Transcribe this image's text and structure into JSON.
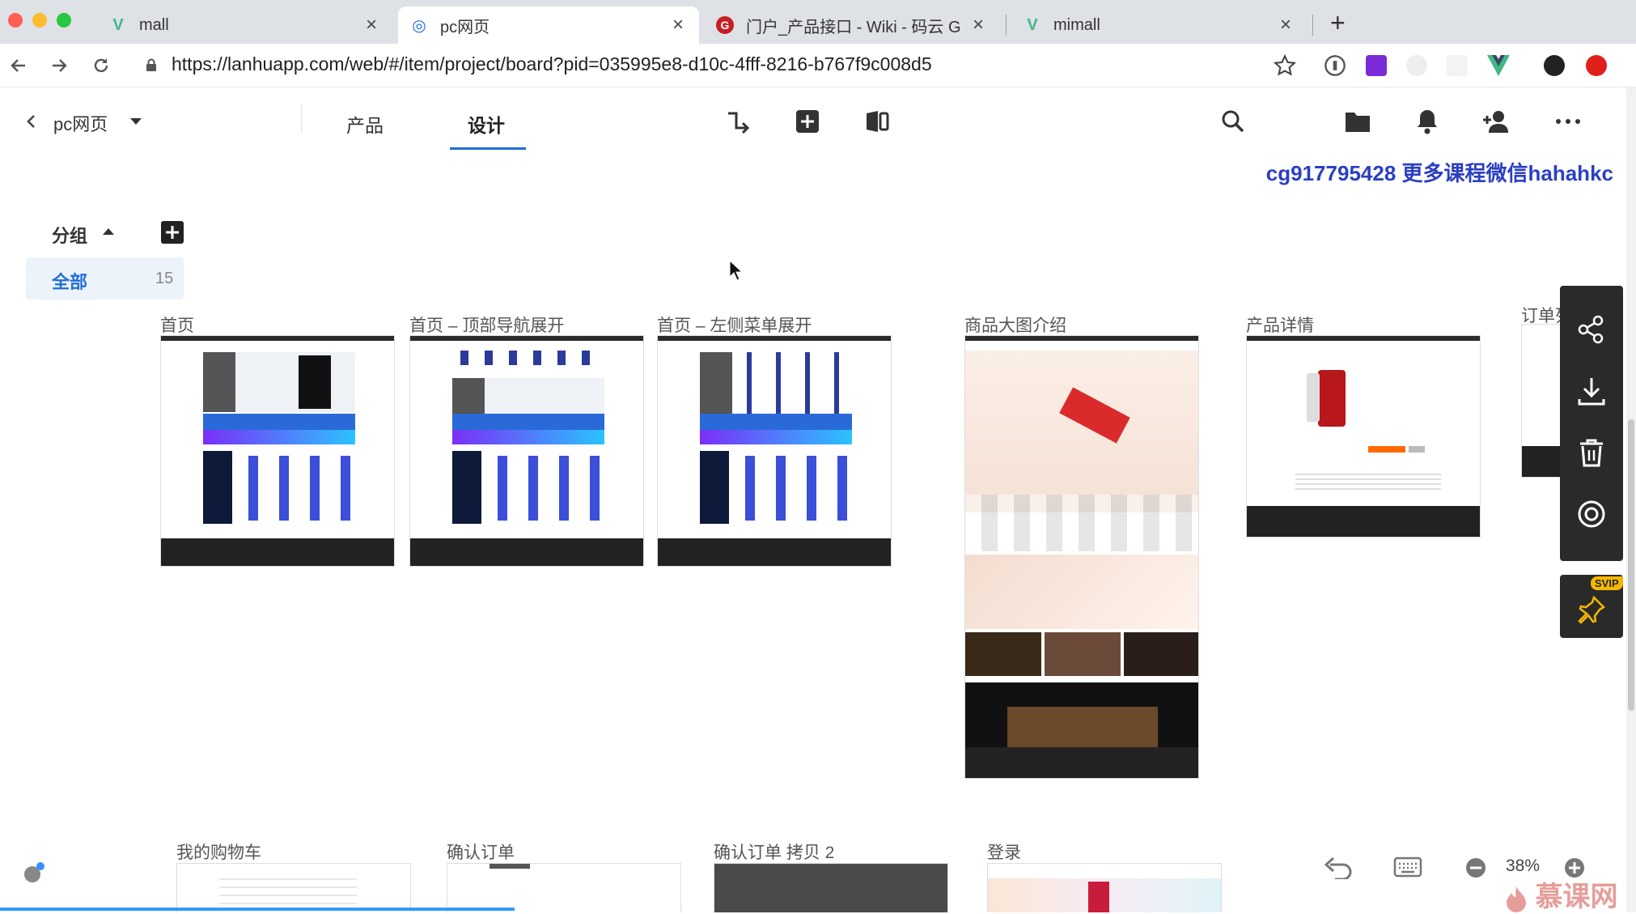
{
  "browser": {
    "tabs": [
      {
        "title": "mall",
        "close": "×"
      },
      {
        "title": "pc网页",
        "close": "×"
      },
      {
        "title": "门户_产品接口 - Wiki - 码云 Gitee",
        "close": "×"
      },
      {
        "title": "mimall",
        "close": "×"
      }
    ],
    "new_tab": "+",
    "url": "https://lanhuapp.com/web/#/item/project/board?pid=035995e8-d10c-4fff-8216-b767f9c008d5"
  },
  "app": {
    "project_name": "pc网页",
    "tabs": [
      "产品",
      "设计"
    ],
    "active_tab": "设计",
    "watermark": "cg917795428 更多课程微信hahahkc"
  },
  "sidebar": {
    "group_label": "分组",
    "all_label": "全部",
    "all_count": "15"
  },
  "boards": [
    {
      "title": "首页"
    },
    {
      "title": "首页 – 顶部导航展开"
    },
    {
      "title": "首页 – 左侧菜单展开"
    },
    {
      "title": "商品大图介绍"
    },
    {
      "title": "产品详情"
    },
    {
      "title": "订单列表"
    }
  ],
  "boards_row2": [
    {
      "title": "我的购物车"
    },
    {
      "title": "确认订单"
    },
    {
      "title": "确认订单 拷贝 2"
    },
    {
      "title": "登录"
    }
  ],
  "toolbar": {
    "svip": "SVIP",
    "zoom": "38%"
  },
  "logo_text": "慕课网",
  "colors": {
    "accent": "#1e6fd9",
    "watermark": "#2b3fc2",
    "dark_panel": "#2a2a2a"
  }
}
